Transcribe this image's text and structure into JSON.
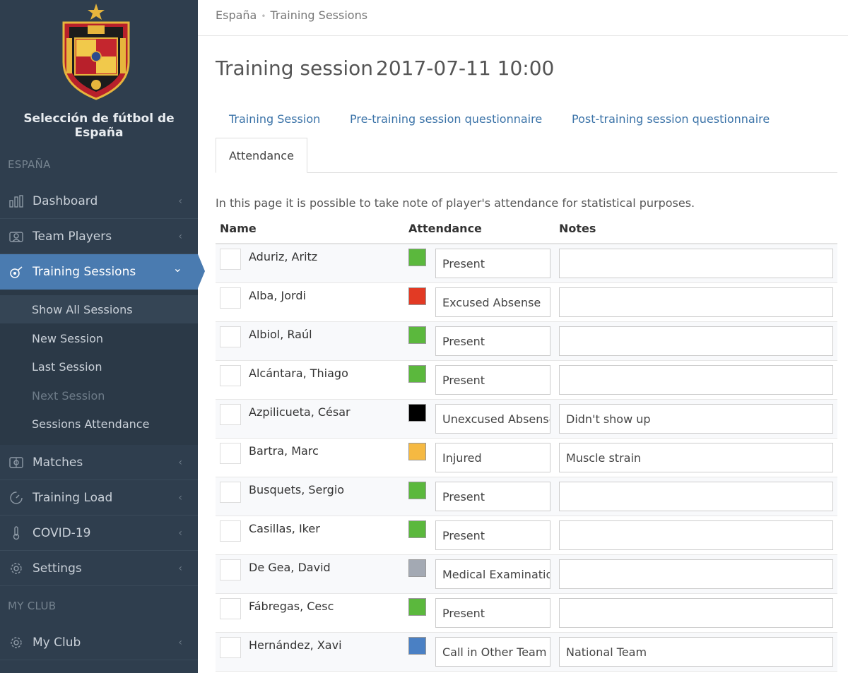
{
  "sidebar": {
    "club_name": "Selección de fútbol de España",
    "section_team": "ESPAÑA",
    "section_club": "MY CLUB",
    "nav": {
      "dashboard": "Dashboard",
      "team_players": "Team Players",
      "training_sessions": "Training Sessions",
      "matches": "Matches",
      "training_load": "Training Load",
      "covid": "COVID-19",
      "settings": "Settings",
      "my_club": "My Club"
    },
    "submenu": {
      "show_all": "Show All Sessions",
      "new_session": "New Session",
      "last_session": "Last Session",
      "next_session": "Next Session",
      "attendance": "Sessions Attendance"
    },
    "chevron_collapsed": "‹",
    "chevron_expanded": "⌄"
  },
  "breadcrumb": {
    "root": "España",
    "current": "Training Sessions",
    "separator": "•"
  },
  "page": {
    "title_prefix": "Training session",
    "title_date": "2017-07-11 10:00",
    "description": "In this page it is possible to take note of player's attendance for statistical purposes."
  },
  "tabs": {
    "training_session": "Training Session",
    "pre_questionnaire": "Pre-training session questionnaire",
    "post_questionnaire": "Post-training session questionnaire",
    "attendance": "Attendance"
  },
  "table": {
    "headers": {
      "name": "Name",
      "attendance": "Attendance",
      "notes": "Notes"
    },
    "rows": [
      {
        "name": "Aduriz, Aritz",
        "attendance": "Present",
        "color": "#5bb83d",
        "notes": ""
      },
      {
        "name": "Alba, Jordi",
        "attendance": "Excused Absense",
        "color": "#e23a24",
        "notes": ""
      },
      {
        "name": "Albiol, Raúl",
        "attendance": "Present",
        "color": "#5bb83d",
        "notes": ""
      },
      {
        "name": "Alcántara, Thiago",
        "attendance": "Present",
        "color": "#5bb83d",
        "notes": ""
      },
      {
        "name": "Azpilicueta, César",
        "attendance": "Unexcused Absense",
        "color": "#000000",
        "notes": "Didn't show up"
      },
      {
        "name": "Bartra, Marc",
        "attendance": "Injured",
        "color": "#f5b942",
        "notes": "Muscle strain"
      },
      {
        "name": "Busquets, Sergio",
        "attendance": "Present",
        "color": "#5bb83d",
        "notes": ""
      },
      {
        "name": "Casillas, Iker",
        "attendance": "Present",
        "color": "#5bb83d",
        "notes": ""
      },
      {
        "name": "De Gea, David",
        "attendance": "Medical Examination",
        "color": "#a3a9b3",
        "notes": ""
      },
      {
        "name": "Fábregas, Cesc",
        "attendance": "Present",
        "color": "#5bb83d",
        "notes": ""
      },
      {
        "name": "Hernández, Xavi",
        "attendance": "Call in Other Team",
        "color": "#4a80c4",
        "notes": "National Team"
      }
    ]
  },
  "colors": {
    "sidebar_bg": "#2f3e4e",
    "accent": "#4a7bb0",
    "link": "#3b73a8"
  }
}
